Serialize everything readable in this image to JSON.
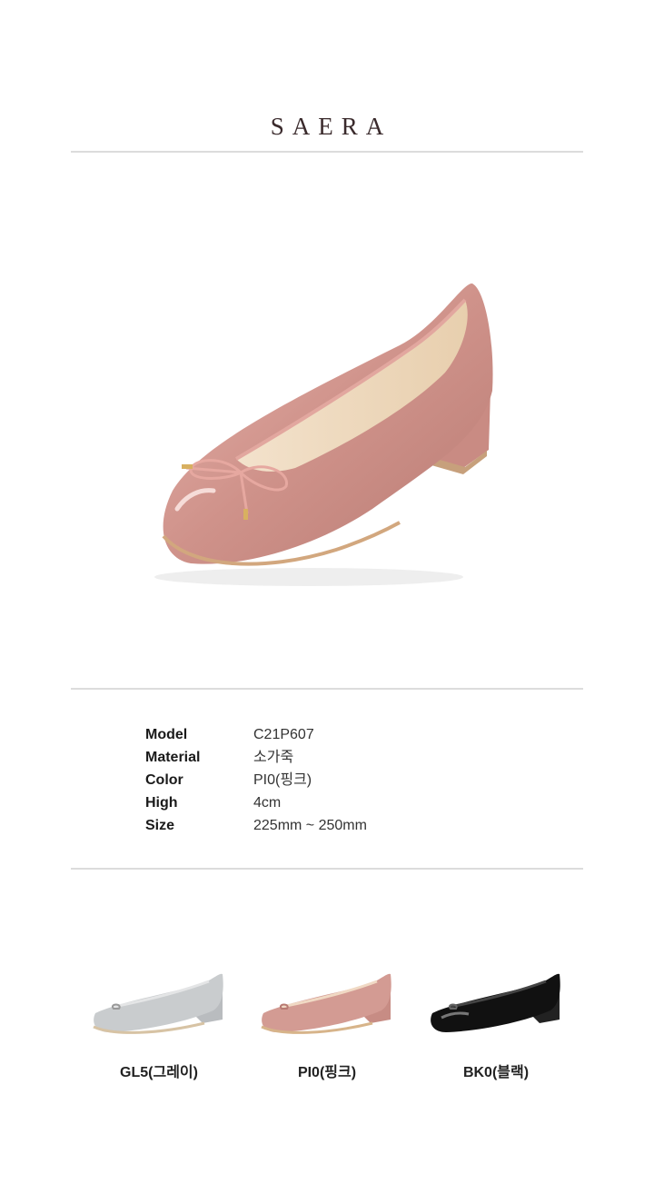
{
  "brand": {
    "name": "SAERA"
  },
  "hero": {
    "icon": "pink-patent-ballet-pump-with-bow",
    "color": "#d39b93"
  },
  "specs": [
    {
      "label": "Model",
      "value": "C21P607"
    },
    {
      "label": "Material",
      "value": "소가죽"
    },
    {
      "label": "Color",
      "value": "PI0(핑크)"
    },
    {
      "label": "High",
      "value": "4cm"
    },
    {
      "label": "Size",
      "value": "225mm ~ 250mm"
    }
  ],
  "colors": [
    {
      "label": "GL5(그레이)",
      "hex": "#c9ccce"
    },
    {
      "label": "PI0(핑크)",
      "hex": "#d39b93"
    },
    {
      "label": "BK0(블랙)",
      "hex": "#111111"
    }
  ]
}
